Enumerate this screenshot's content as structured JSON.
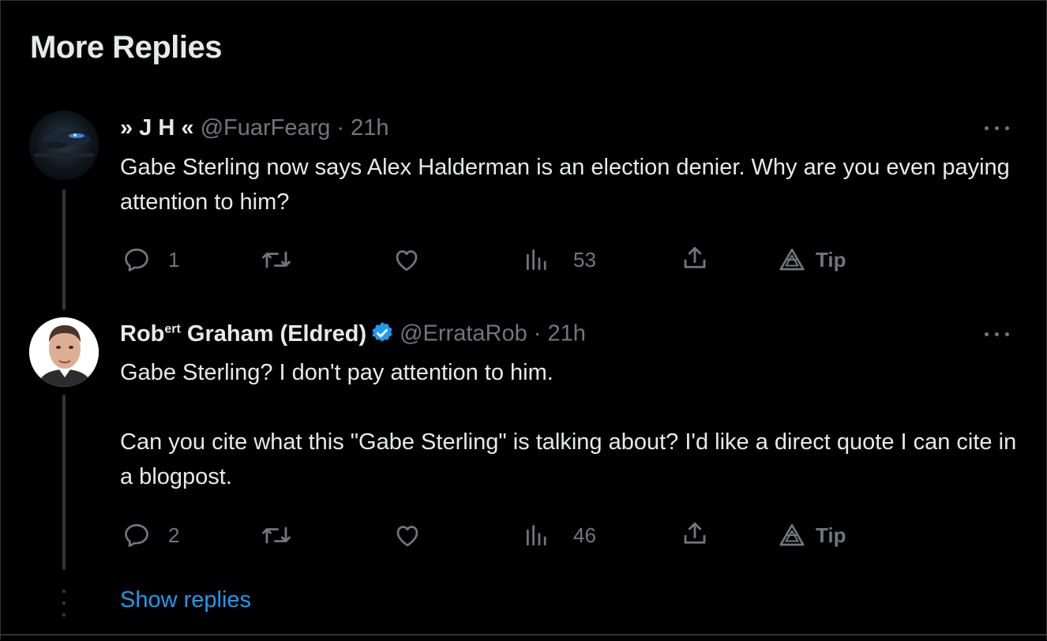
{
  "section": {
    "title": "More Replies"
  },
  "replies": [
    {
      "display_name": "» J H «",
      "handle": "@FuarFearg",
      "separator": " · ",
      "time": "21h",
      "paragraphs": [
        "Gabe Sterling now says Alex Halderman is an election denier.  Why are you even paying attention to him?"
      ],
      "reply_count": "1",
      "repost_count": "",
      "like_count": "",
      "view_count": "53",
      "tip_label": "Tip"
    },
    {
      "display_name_main": "Rob",
      "display_name_sup": "ert",
      "display_name_rest": " Graham (Eldred)",
      "verified": true,
      "handle": "@ErrataRob",
      "separator": " · ",
      "time": "21h",
      "paragraphs": [
        "Gabe Sterling? I don't pay attention to him.",
        "Can you cite what this \"Gabe Sterling\" is talking about? I'd like a direct quote I can cite in a blogpost."
      ],
      "reply_count": "2",
      "repost_count": "",
      "like_count": "",
      "view_count": "46",
      "tip_label": "Tip"
    }
  ],
  "show_replies_label": "Show replies",
  "colors": {
    "background": "#000000",
    "text": "#e7e9ea",
    "muted": "#71767b",
    "accent": "#1d9bf0",
    "verified": "#1d9bf0"
  },
  "icons": [
    "reply-icon",
    "repost-icon",
    "like-icon",
    "views-icon",
    "share-icon",
    "tip-icon",
    "more-icon",
    "verified-badge-icon"
  ]
}
